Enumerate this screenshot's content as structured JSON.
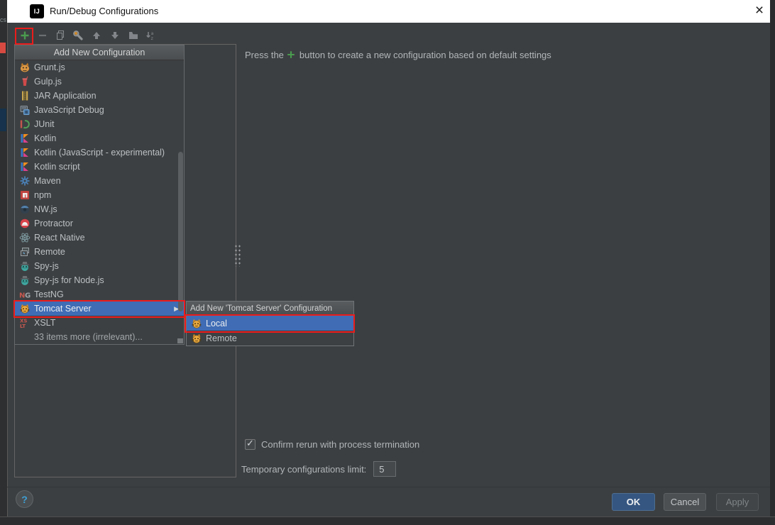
{
  "window": {
    "title": "Run/Debug Configurations",
    "logo_text": "IJ",
    "close_glyph": "×"
  },
  "background": {
    "left_text": "cs"
  },
  "toolbar": {
    "buttons": [
      {
        "name": "add",
        "icon": "add"
      },
      {
        "name": "remove",
        "icon": "remove"
      },
      {
        "name": "copy",
        "icon": "copy"
      },
      {
        "name": "edit-defaults",
        "icon": "settings"
      },
      {
        "name": "move-up",
        "icon": "move-up"
      },
      {
        "name": "move-down",
        "icon": "move-down"
      },
      {
        "name": "create-folder",
        "icon": "folder"
      },
      {
        "name": "sort-alphabetically",
        "icon": "sort"
      }
    ]
  },
  "menu": {
    "header": "Add New Configuration",
    "items": [
      {
        "label": "Grunt.js",
        "icon": "grunt"
      },
      {
        "label": "Gulp.js",
        "icon": "gulp"
      },
      {
        "label": "JAR Application",
        "icon": "jar"
      },
      {
        "label": "JavaScript Debug",
        "icon": "jsdebug"
      },
      {
        "label": "JUnit",
        "icon": "junit"
      },
      {
        "label": "Kotlin",
        "icon": "kotlin"
      },
      {
        "label": "Kotlin (JavaScript - experimental)",
        "icon": "kotlin"
      },
      {
        "label": "Kotlin script",
        "icon": "kotlin"
      },
      {
        "label": "Maven",
        "icon": "maven"
      },
      {
        "label": "npm",
        "icon": "npm"
      },
      {
        "label": "NW.js",
        "icon": "nwjs"
      },
      {
        "label": "Protractor",
        "icon": "protractor"
      },
      {
        "label": "React Native",
        "icon": "react"
      },
      {
        "label": "Remote",
        "icon": "remote"
      },
      {
        "label": "Spy-js",
        "icon": "spy"
      },
      {
        "label": "Spy-js for Node.js",
        "icon": "spy"
      },
      {
        "label": "TestNG",
        "icon": "testng"
      },
      {
        "label": "Tomcat Server",
        "icon": "tomcat",
        "selected": true,
        "has_submenu": true
      },
      {
        "label": "XSLT",
        "icon": "xslt"
      },
      {
        "label": "33 items more (irrelevant)...",
        "icon": "none",
        "dim": true
      }
    ]
  },
  "submenu": {
    "header": "Add New 'Tomcat Server' Configuration",
    "items": [
      {
        "label": "Local",
        "icon": "tomcat",
        "selected": true
      },
      {
        "label": "Remote",
        "icon": "tomcat"
      }
    ]
  },
  "content": {
    "hint_prefix": "Press the",
    "hint_suffix": "button to create a new configuration based on default settings",
    "confirm_label": "Confirm rerun with process termination",
    "confirm_checked": true,
    "check_glyph": "✓",
    "temp_label": "Temporary configurations limit:",
    "temp_value": "5"
  },
  "footer": {
    "ok_label": "OK",
    "cancel_label": "Cancel",
    "apply_label": "Apply",
    "help_glyph": "?"
  },
  "colors": {
    "annotation_red": "#ec1c1c",
    "selection_blue": "#3f6cb5",
    "plus_green": "#4a9b4f",
    "ok_button_blue": "#355681",
    "dialog_bg": "#3c3f41",
    "titlebar_bg": "#ffffff"
  }
}
